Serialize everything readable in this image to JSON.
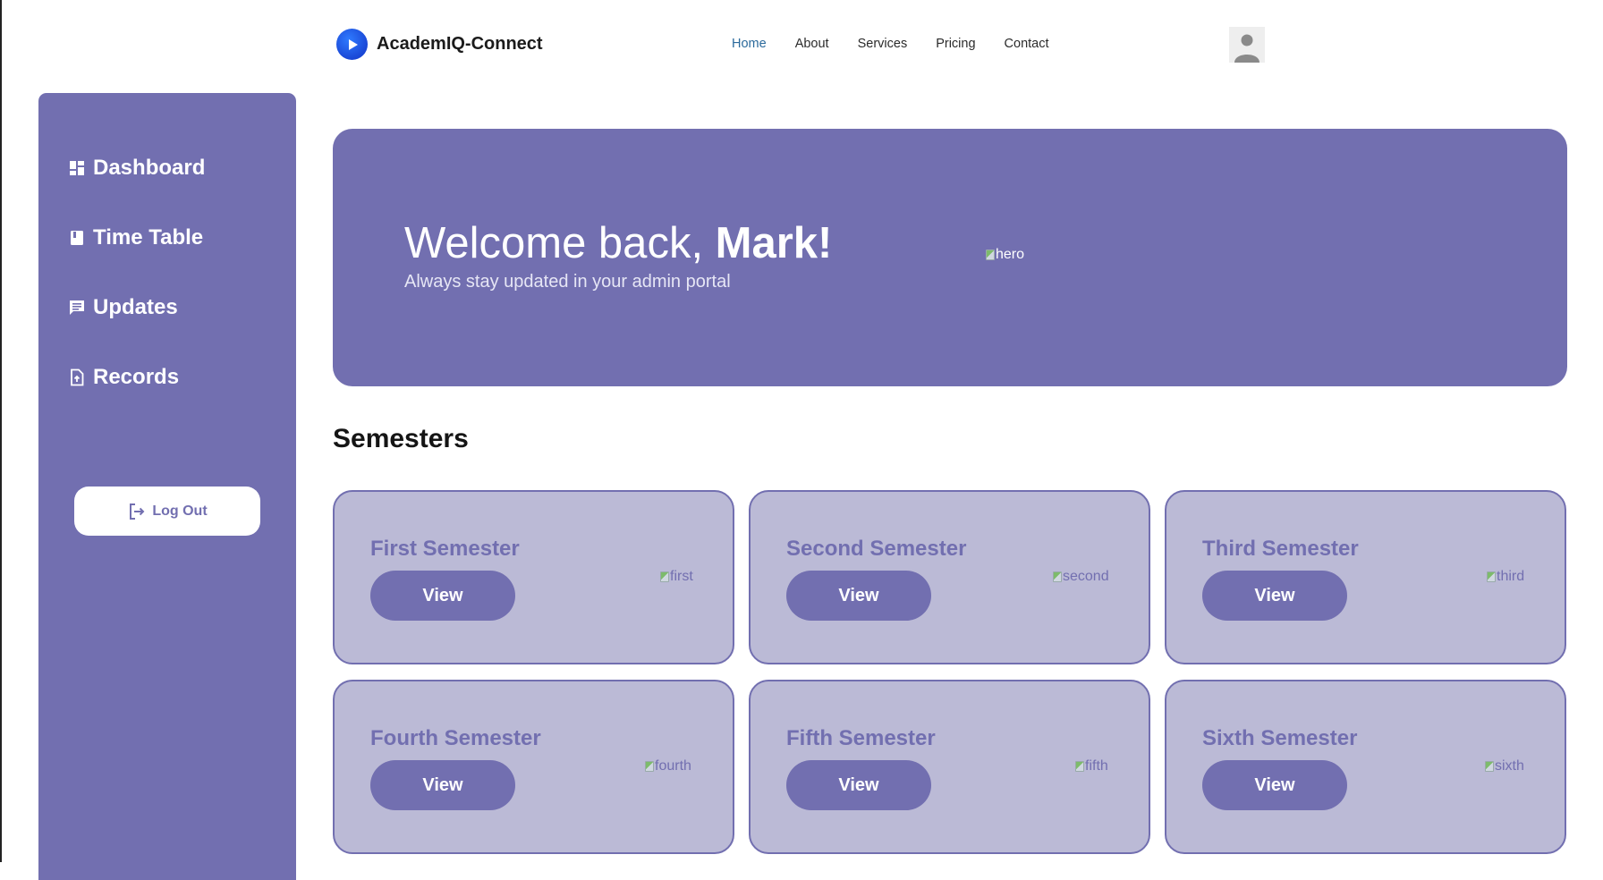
{
  "brand": {
    "name": "AcademIQ-Connect",
    "logo_icon": "play-circle-icon",
    "logo_color": "#1f5bef"
  },
  "nav": {
    "items": [
      {
        "label": "Home",
        "active": true
      },
      {
        "label": "About",
        "active": false
      },
      {
        "label": "Services",
        "active": false
      },
      {
        "label": "Pricing",
        "active": false
      },
      {
        "label": "Contact",
        "active": false
      }
    ],
    "active_color": "#2b6a9c"
  },
  "avatar": {
    "icon": "user-avatar-icon"
  },
  "sidebar": {
    "bg_color": "#726fb0",
    "items": [
      {
        "label": "Dashboard",
        "icon": "dashboard-icon"
      },
      {
        "label": "Time Table",
        "icon": "book-icon"
      },
      {
        "label": "Updates",
        "icon": "chat-icon"
      },
      {
        "label": "Records",
        "icon": "file-upload-icon"
      }
    ],
    "logout_label": "Log Out",
    "logout_icon": "logout-icon"
  },
  "hero": {
    "greeting": "Welcome back, ",
    "name": "Mark!",
    "subtitle": "Always stay updated in your admin portal",
    "image_alt": "hero"
  },
  "semesters": {
    "title": "Semesters",
    "view_label": "View",
    "cards": [
      {
        "title": "First Semester",
        "image_alt": "first"
      },
      {
        "title": "Second Semester",
        "image_alt": "second"
      },
      {
        "title": "Third Semester",
        "image_alt": "third"
      },
      {
        "title": "Fourth Semester",
        "image_alt": "fourth"
      },
      {
        "title": "Fifth Semester",
        "image_alt": "fifth"
      },
      {
        "title": "Sixth Semester",
        "image_alt": "sixth"
      }
    ],
    "card_bg": "#bbbad6",
    "accent": "#726fb0"
  }
}
